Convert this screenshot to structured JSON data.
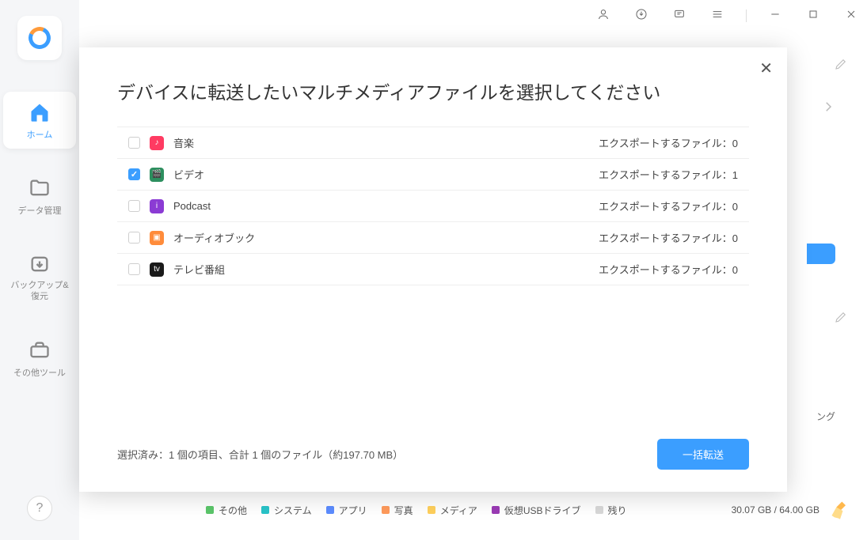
{
  "sidebar": {
    "items": [
      {
        "label": "ホーム"
      },
      {
        "label": "データ管理"
      },
      {
        "label": "バックアップ&\n復元"
      },
      {
        "label": "その他ツール"
      }
    ]
  },
  "storage": {
    "legend": [
      {
        "label": "その他",
        "color": "#5bc66a"
      },
      {
        "label": "システム",
        "color": "#29c4c9"
      },
      {
        "label": "アプリ",
        "color": "#5c8cff"
      },
      {
        "label": "写真",
        "color": "#ff9b5c"
      },
      {
        "label": "メディア",
        "color": "#ffd05c"
      },
      {
        "label": "仮想USBドライブ",
        "color": "#9b3bb5"
      },
      {
        "label": "残り",
        "color": "#d8d8d8"
      }
    ],
    "text": "30.07 GB / 64.00 GB"
  },
  "truncated_text": "ング",
  "modal": {
    "title": "デバイスに転送したいマルチメディアファイルを選択してください",
    "export_label": "エクスポートするファイル：",
    "rows": [
      {
        "name": "音楽",
        "count": "0",
        "checked": false,
        "bg": "#ff3b62",
        "glyph": "♪"
      },
      {
        "name": "ビデオ",
        "count": "1",
        "checked": true,
        "bg": "#2d8f5f",
        "glyph": "🎬"
      },
      {
        "name": "Podcast",
        "count": "0",
        "checked": false,
        "bg": "#8b3bd4",
        "glyph": "i"
      },
      {
        "name": "オーディオブック",
        "count": "0",
        "checked": false,
        "bg": "#ff8c3b",
        "glyph": "▣"
      },
      {
        "name": "テレビ番組",
        "count": "0",
        "checked": false,
        "bg": "#1a1a1a",
        "glyph": "tv"
      }
    ],
    "summary": "選択済み：1 個の項目、合計 1 個のファイル（約197.70 MB）",
    "button": "一括転送"
  }
}
